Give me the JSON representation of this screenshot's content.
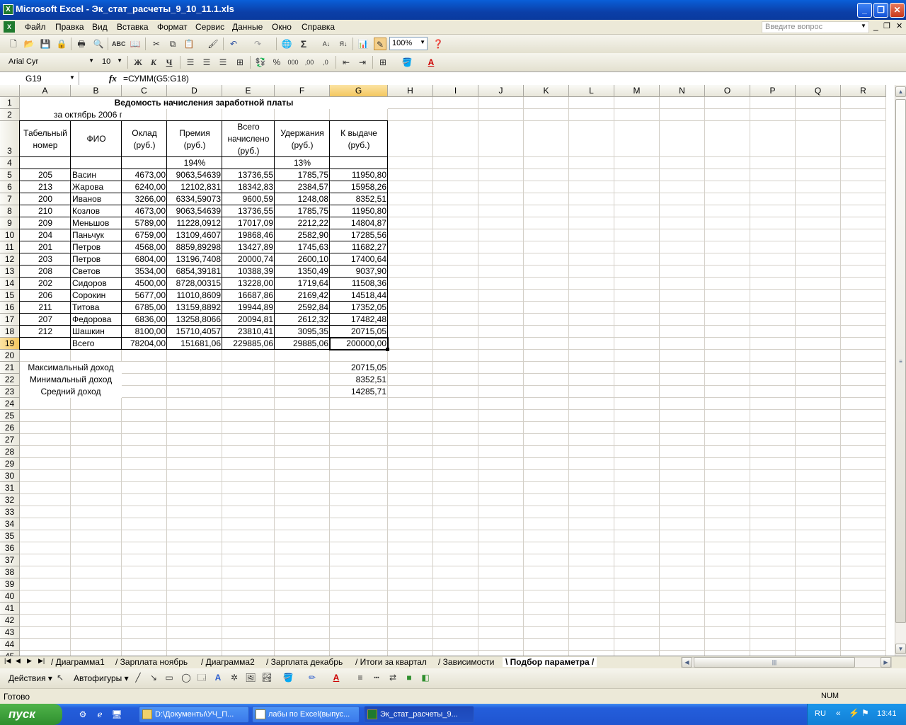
{
  "window": {
    "title": "Microsoft Excel - Эк_стат_расчеты_9_10_11.1.xls"
  },
  "menu": {
    "items": [
      "Файл",
      "Правка",
      "Вид",
      "Вставка",
      "Формат",
      "Сервис",
      "Данные",
      "Окно",
      "Справка"
    ],
    "help_placeholder": "Введите вопрос"
  },
  "toolbar": {
    "zoom": "100%",
    "font_name": "Arial Cyr",
    "font_size": "10"
  },
  "formula_bar": {
    "name_box": "G19",
    "fx": "fx",
    "formula": "=СУММ(G5:G18)"
  },
  "columns": [
    "A",
    "B",
    "C",
    "D",
    "E",
    "F",
    "G",
    "H",
    "I",
    "J",
    "K",
    "L",
    "M",
    "N",
    "O",
    "P",
    "Q",
    "R"
  ],
  "sheet": {
    "title": "Ведомость начисления заработной платы",
    "subtitle": "за октябрь 2006 г.",
    "headers": {
      "A": [
        "Табельный",
        "номер"
      ],
      "B": [
        "ФИО"
      ],
      "C": [
        "Оклад",
        "(руб.)"
      ],
      "D": [
        "Премия",
        "(руб.)"
      ],
      "E": [
        "Всего",
        "начислено",
        "(руб.)"
      ],
      "F": [
        "Удержания",
        "(руб.)"
      ],
      "G": [
        "К выдаче",
        "(руб.)"
      ]
    },
    "row4": {
      "D": "194%",
      "F": "13%"
    },
    "rows": [
      [
        "205",
        "Васин",
        "4673,00",
        "9063,54639",
        "13736,55",
        "1785,75",
        "11950,80"
      ],
      [
        "213",
        "Жарова",
        "6240,00",
        "12102,831",
        "18342,83",
        "2384,57",
        "15958,26"
      ],
      [
        "200",
        "Иванов",
        "3266,00",
        "6334,59073",
        "9600,59",
        "1248,08",
        "8352,51"
      ],
      [
        "210",
        "Козлов",
        "4673,00",
        "9063,54639",
        "13736,55",
        "1785,75",
        "11950,80"
      ],
      [
        "209",
        "Меньшов",
        "5789,00",
        "11228,0912",
        "17017,09",
        "2212,22",
        "14804,87"
      ],
      [
        "204",
        "Паньчук",
        "6759,00",
        "13109,4607",
        "19868,46",
        "2582,90",
        "17285,56"
      ],
      [
        "201",
        "Петров",
        "4568,00",
        "8859,89298",
        "13427,89",
        "1745,63",
        "11682,27"
      ],
      [
        "203",
        "Петров",
        "6804,00",
        "13196,7408",
        "20000,74",
        "2600,10",
        "17400,64"
      ],
      [
        "208",
        "Светов",
        "3534,00",
        "6854,39181",
        "10388,39",
        "1350,49",
        "9037,90"
      ],
      [
        "202",
        "Сидоров",
        "4500,00",
        "8728,00315",
        "13228,00",
        "1719,64",
        "11508,36"
      ],
      [
        "206",
        "Сорокин",
        "5677,00",
        "11010,8609",
        "16687,86",
        "2169,42",
        "14518,44"
      ],
      [
        "211",
        "Титова",
        "6785,00",
        "13159,8892",
        "19944,89",
        "2592,84",
        "17352,05"
      ],
      [
        "207",
        "Федорова",
        "6836,00",
        "13258,8066",
        "20094,81",
        "2612,32",
        "17482,48"
      ],
      [
        "212",
        "Шашкин",
        "8100,00",
        "15710,4057",
        "23810,41",
        "3095,35",
        "20715,05"
      ]
    ],
    "total": {
      "label": "Всего",
      "C": "78204,00",
      "D": "151681,06",
      "E": "229885,06",
      "F": "29885,06",
      "G": "200000,00"
    },
    "stats": [
      {
        "label": "Максимальный доход",
        "value": "20715,05"
      },
      {
        "label": "Минимальный доход",
        "value": "8352,51"
      },
      {
        "label": "Средний доход",
        "value": "14285,71"
      }
    ]
  },
  "tabs": [
    "Диаграмма1",
    "Зарплата ноябрь",
    "Диаграмма2",
    "Зарплата декабрь",
    "Итоги за квартал",
    "Зависимости",
    "Подбор параметра"
  ],
  "active_tab": "Подбор параметра",
  "draw_toolbar": {
    "actions": "Действия",
    "autoshapes": "Автофигуры"
  },
  "status": {
    "left": "Готово",
    "num": "NUM"
  },
  "taskbar": {
    "start": "пуск",
    "tasks": [
      "D:\\Документы\\УЧ_П...",
      "лабы по Excel(выпус...",
      "Эк_стат_расчеты_9..."
    ],
    "lang": "RU",
    "clock": "13:41"
  }
}
